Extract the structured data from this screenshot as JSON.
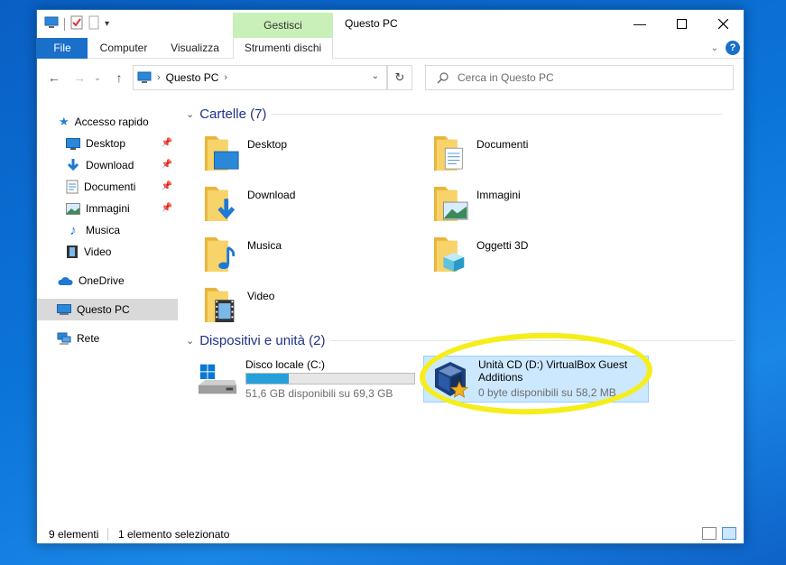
{
  "window": {
    "title": "Questo PC",
    "contextual_group": "Gestisci"
  },
  "ribbon": {
    "tabs": [
      {
        "label": "File"
      },
      {
        "label": "Computer"
      },
      {
        "label": "Visualizza"
      },
      {
        "label": "Strumenti dischi"
      }
    ]
  },
  "address": {
    "crumb": "Questo PC",
    "search_placeholder": "Cerca in Questo PC"
  },
  "sidebar": {
    "items": [
      {
        "label": "Accesso rapido"
      },
      {
        "label": "Desktop"
      },
      {
        "label": "Download"
      },
      {
        "label": "Documenti"
      },
      {
        "label": "Immagini"
      },
      {
        "label": "Musica"
      },
      {
        "label": "Video"
      },
      {
        "label": "OneDrive"
      },
      {
        "label": "Questo PC"
      },
      {
        "label": "Rete"
      }
    ]
  },
  "groups": {
    "folders": {
      "title": "Cartelle (7)"
    },
    "devices": {
      "title": "Dispositivi e unità (2)"
    }
  },
  "folders": [
    {
      "label": "Desktop"
    },
    {
      "label": "Documenti"
    },
    {
      "label": "Download"
    },
    {
      "label": "Immagini"
    },
    {
      "label": "Musica"
    },
    {
      "label": "Oggetti 3D"
    },
    {
      "label": "Video"
    }
  ],
  "drives": [
    {
      "name": "Disco locale (C:)",
      "space": "51,6 GB disponibili su 69,3 GB",
      "used_fraction": 0.255
    },
    {
      "name": "Unità CD (D:) VirtualBox Guest",
      "name2": "Additions",
      "space": "0 byte disponibili su 58,2 MB"
    }
  ],
  "status": {
    "count": "9 elementi",
    "selected": "1 elemento selezionato"
  },
  "colors": {
    "accent": "#1a6fc9",
    "selection": "#cce8ff",
    "highlight": "#f5ee1a",
    "folder": "#f3c54f"
  }
}
